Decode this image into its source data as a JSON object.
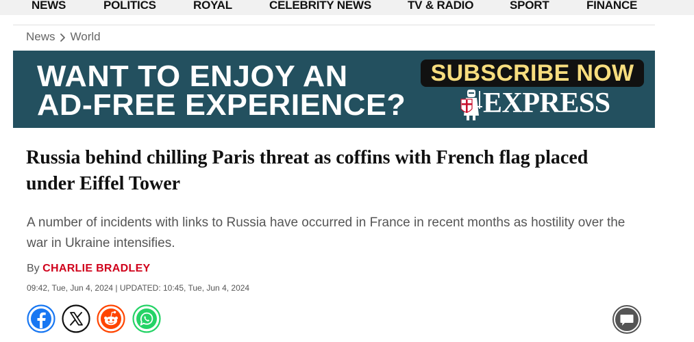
{
  "nav": {
    "items": [
      "NEWS",
      "POLITICS",
      "ROYAL",
      "CELEBRITY NEWS",
      "TV & RADIO",
      "SPORT",
      "FINANCE"
    ]
  },
  "breadcrumb": {
    "items": [
      "News",
      "World"
    ],
    "separator_icon": "chevron-right-icon"
  },
  "banner": {
    "line1": "WANT TO ENJOY AN",
    "line2": "AD-FREE EXPERIENCE?",
    "cta": "SUBSCRIBE NOW",
    "brand": "EXPRESS",
    "colors": {
      "background": "#23505f",
      "cta_text": "#f7dd7e",
      "cta_bg": "#111111",
      "text": "#ffffff"
    }
  },
  "article": {
    "headline": "Russia behind chilling Paris threat as coffins with French flag placed under Eiffel Tower",
    "standfirst": "A number of incidents with links to Russia have occurred in France in recent months as hostility over the war in Ukraine intensifies.",
    "byline_prefix": "By",
    "author": "Charlie Bradley",
    "dateline": "09:42, Tue, Jun 4, 2024 | UPDATED: 10:45, Tue, Jun 4, 2024"
  },
  "share": {
    "buttons": [
      {
        "name": "facebook",
        "icon": "facebook-icon",
        "color": "#1877f2"
      },
      {
        "name": "x",
        "icon": "x-icon",
        "color": "#111111"
      },
      {
        "name": "reddit",
        "icon": "reddit-icon",
        "color": "#ff4500"
      },
      {
        "name": "whatsapp",
        "icon": "whatsapp-icon",
        "color": "#25d366"
      }
    ],
    "comment_icon": "comment-icon"
  },
  "colors": {
    "accent_red": "#d0011b",
    "nav_bg": "#f1f1f1"
  }
}
